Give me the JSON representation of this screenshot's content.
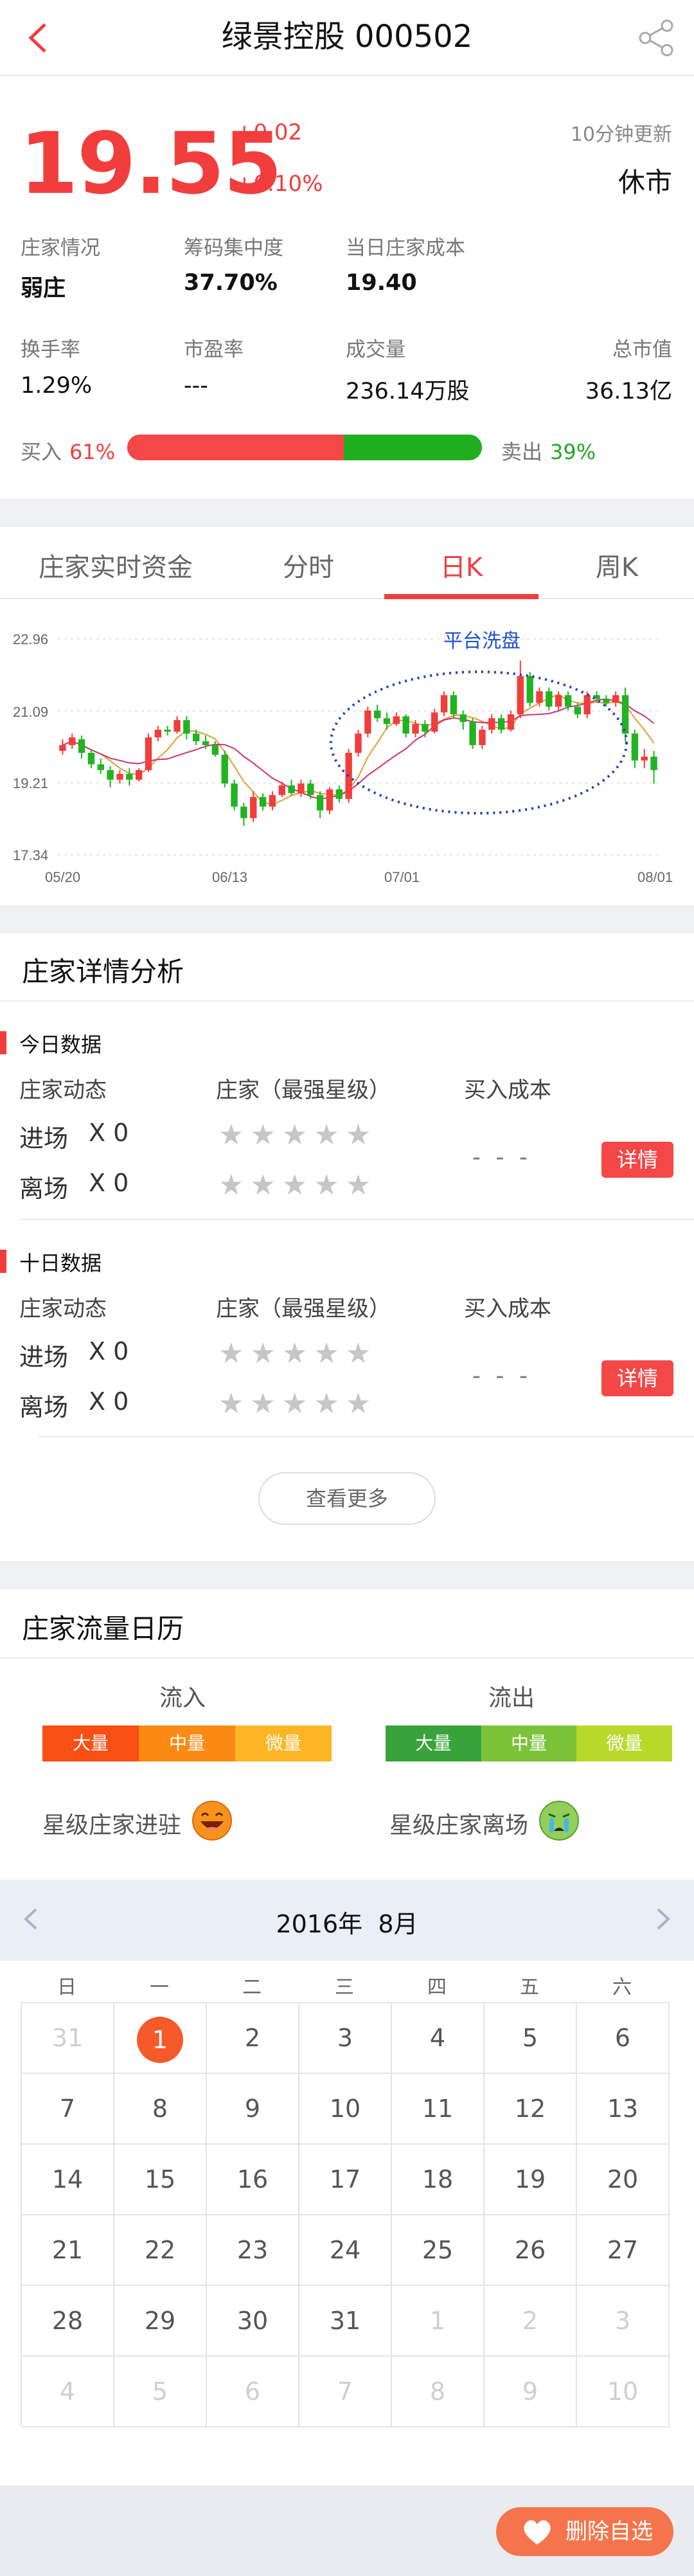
{
  "header": {
    "title": "绿景控股  000502"
  },
  "quote": {
    "price": "19.55",
    "change": "+0.02",
    "change_pct": "+0.10%",
    "update_note": "10分钟更新",
    "market_status": "休市",
    "stats_row1": [
      {
        "label": "庄家情况",
        "value": "弱庄"
      },
      {
        "label": "筹码集中度",
        "value": "37.70%"
      },
      {
        "label": "当日庄家成本",
        "value": "19.40"
      }
    ],
    "stats_row2": [
      {
        "label": "换手率",
        "value": "1.29%"
      },
      {
        "label": "市盈率",
        "value": "---"
      },
      {
        "label": "成交量",
        "value": "236.14万股"
      },
      {
        "label": "总市值",
        "value": "36.13亿"
      }
    ],
    "buy_label": "买入",
    "buy_pct": "61%",
    "buy_fraction": 0.61,
    "sell_label": "卖出",
    "sell_pct": "39%"
  },
  "tabs": [
    {
      "label": "庄家实时资金"
    },
    {
      "label": "分时"
    },
    {
      "label": "日K",
      "active": true
    },
    {
      "label": "周K"
    }
  ],
  "chart_data": {
    "type": "candlestick",
    "annotation": "平台洗盘",
    "y_ticks": [
      "22.96",
      "21.09",
      "19.21",
      "17.34"
    ],
    "ylim": [
      17.34,
      22.96
    ],
    "x_ticks": [
      "05/20",
      "06/13",
      "07/01",
      "08/01"
    ],
    "colors": {
      "up": "#f23d3d",
      "down": "#22b322",
      "ma5": "#e0a030",
      "ma10": "#d0307a",
      "grid": "#cfcfcf"
    },
    "candles": [
      [
        20.05,
        20.2,
        20.35,
        19.95
      ],
      [
        20.2,
        20.4,
        20.5,
        20.1
      ],
      [
        20.35,
        20.0,
        20.45,
        19.85
      ],
      [
        20.0,
        19.7,
        20.1,
        19.6
      ],
      [
        19.7,
        19.55,
        19.85,
        19.45
      ],
      [
        19.55,
        19.3,
        19.65,
        19.1
      ],
      [
        19.3,
        19.45,
        19.55,
        19.2
      ],
      [
        19.45,
        19.3,
        19.6,
        19.15
      ],
      [
        19.3,
        19.55,
        19.6,
        19.25
      ],
      [
        19.55,
        20.4,
        20.5,
        19.5
      ],
      [
        20.4,
        20.6,
        20.7,
        20.3
      ],
      [
        20.6,
        20.55,
        20.7,
        20.45
      ],
      [
        20.55,
        20.85,
        20.95,
        20.5
      ],
      [
        20.85,
        20.5,
        20.95,
        20.35
      ],
      [
        20.5,
        20.3,
        20.6,
        20.2
      ],
      [
        20.3,
        20.2,
        20.45,
        20.1
      ],
      [
        20.2,
        19.95,
        20.3,
        19.9
      ],
      [
        19.95,
        19.2,
        20.05,
        19.1
      ],
      [
        19.2,
        18.6,
        19.3,
        18.5
      ],
      [
        18.6,
        18.3,
        18.7,
        18.1
      ],
      [
        18.3,
        18.85,
        19.0,
        18.2
      ],
      [
        18.85,
        18.6,
        18.95,
        18.5
      ],
      [
        18.6,
        18.9,
        19.0,
        18.5
      ],
      [
        18.9,
        19.15,
        19.25,
        18.85
      ],
      [
        19.15,
        18.95,
        19.3,
        18.9
      ],
      [
        18.95,
        19.2,
        19.3,
        18.85
      ],
      [
        19.2,
        18.9,
        19.3,
        18.8
      ],
      [
        18.9,
        18.5,
        19.0,
        18.3
      ],
      [
        18.5,
        19.05,
        19.1,
        18.4
      ],
      [
        19.05,
        18.8,
        19.15,
        18.7
      ],
      [
        18.8,
        20.0,
        20.1,
        18.7
      ],
      [
        20.0,
        20.5,
        20.6,
        19.9
      ],
      [
        20.5,
        21.1,
        21.2,
        20.4
      ],
      [
        21.1,
        20.9,
        21.25,
        20.8
      ],
      [
        20.9,
        20.75,
        21.05,
        20.6
      ],
      [
        20.75,
        20.95,
        21.05,
        20.7
      ],
      [
        20.95,
        20.5,
        21.0,
        20.4
      ],
      [
        20.5,
        20.75,
        20.85,
        20.4
      ],
      [
        20.75,
        20.55,
        20.85,
        20.4
      ],
      [
        20.55,
        21.05,
        21.15,
        20.5
      ],
      [
        21.05,
        21.5,
        21.6,
        20.95
      ],
      [
        21.5,
        21.0,
        21.6,
        20.9
      ],
      [
        21.0,
        20.8,
        21.1,
        20.6
      ],
      [
        20.8,
        20.2,
        20.9,
        20.1
      ],
      [
        20.2,
        20.6,
        20.7,
        20.1
      ],
      [
        20.6,
        20.9,
        21.0,
        20.5
      ],
      [
        20.9,
        20.6,
        21.0,
        20.5
      ],
      [
        20.6,
        21.0,
        21.1,
        20.55
      ],
      [
        21.0,
        22.0,
        22.4,
        20.9
      ],
      [
        22.0,
        21.3,
        22.1,
        21.2
      ],
      [
        21.3,
        21.6,
        21.7,
        21.2
      ],
      [
        21.6,
        21.2,
        21.7,
        21.1
      ],
      [
        21.2,
        21.5,
        21.6,
        21.1
      ],
      [
        21.5,
        21.2,
        21.6,
        21.1
      ],
      [
        21.2,
        21.0,
        21.3,
        20.9
      ],
      [
        21.0,
        21.5,
        21.6,
        20.9
      ],
      [
        21.5,
        21.4,
        21.6,
        21.3
      ],
      [
        21.4,
        21.3,
        21.5,
        21.2
      ],
      [
        21.3,
        21.5,
        21.6,
        21.2
      ],
      [
        21.5,
        20.5,
        21.7,
        20.3
      ],
      [
        20.5,
        19.8,
        20.6,
        19.6
      ],
      [
        19.8,
        19.9,
        20.1,
        19.6
      ],
      [
        19.9,
        19.55,
        20.05,
        19.2
      ]
    ]
  },
  "analysis": {
    "title": "庄家详情分析",
    "today": {
      "title": "今日数据",
      "col1": "庄家动态",
      "col2": "庄家（最强星级）",
      "col3": "买入成本",
      "enter_label": "进场",
      "enter_count": "X 0",
      "exit_label": "离场",
      "exit_count": "X 0",
      "stars": "★★★★★",
      "cost": "- - -",
      "detail": "详情"
    },
    "ten_day": {
      "title": "十日数据",
      "col1": "庄家动态",
      "col2": "庄家（最强星级）",
      "col3": "买入成本",
      "enter_label": "进场",
      "enter_count": "X 0",
      "exit_label": "离场",
      "exit_count": "X 0",
      "stars": "★★★★★",
      "cost": "- - -",
      "detail": "详情"
    },
    "more": "查看更多"
  },
  "calendar_section": {
    "title": "庄家流量日历",
    "inflow": "流入",
    "outflow": "流出",
    "inflow_levels": [
      "大量",
      "中量",
      "微量"
    ],
    "outflow_levels": [
      "大量",
      "中量",
      "微量"
    ],
    "inflow_colors": [
      "#fa4f14",
      "#fb8a14",
      "#fdb525"
    ],
    "outflow_colors": [
      "#38a33b",
      "#7cc33a",
      "#b8d92a"
    ],
    "star_enter": "星级庄家进驻",
    "star_exit": "星级庄家离场",
    "year": "2016年",
    "month": "8月",
    "weekdays": [
      "日",
      "一",
      "二",
      "三",
      "四",
      "五",
      "六"
    ],
    "days": [
      [
        "31",
        "1",
        "2",
        "3",
        "4",
        "5",
        "6"
      ],
      [
        "7",
        "8",
        "9",
        "10",
        "11",
        "12",
        "13"
      ],
      [
        "14",
        "15",
        "16",
        "17",
        "18",
        "19",
        "20"
      ],
      [
        "21",
        "22",
        "23",
        "24",
        "25",
        "26",
        "27"
      ],
      [
        "28",
        "29",
        "30",
        "31",
        "1",
        "2",
        "3"
      ],
      [
        "4",
        "5",
        "6",
        "7",
        "8",
        "9",
        "10"
      ]
    ]
  },
  "footer": {
    "remove_label": "删除自选"
  }
}
